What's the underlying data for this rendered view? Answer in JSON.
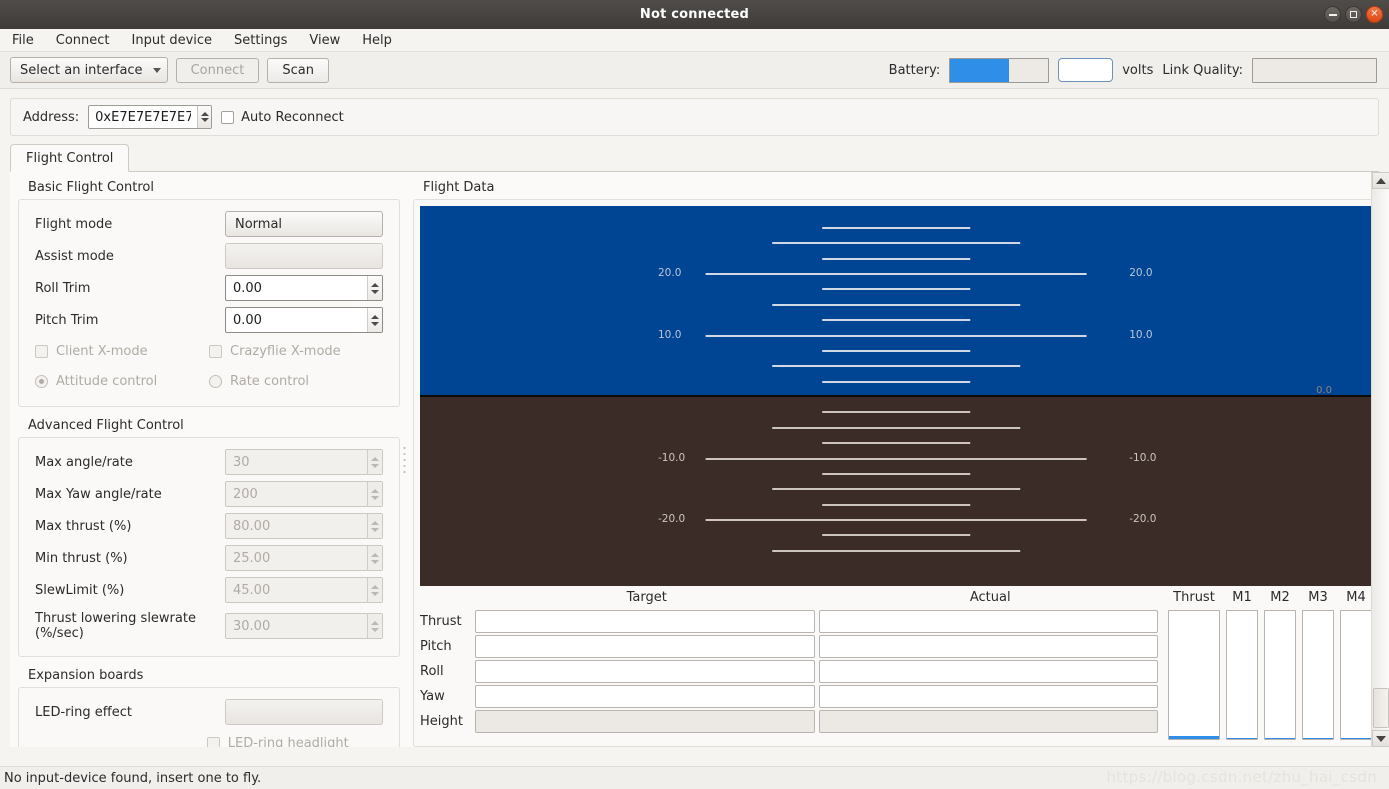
{
  "window": {
    "title": "Not connected",
    "minimize_label": "minimize",
    "maximize_label": "maximize",
    "close_label": "close"
  },
  "menubar": {
    "items": [
      {
        "label": "File"
      },
      {
        "label": "Connect"
      },
      {
        "label": "Input device"
      },
      {
        "label": "Settings"
      },
      {
        "label": "View"
      },
      {
        "label": "Help"
      }
    ]
  },
  "toolbar": {
    "interface_select": "Select an interface",
    "connect_label": "Connect",
    "scan_label": "Scan",
    "battery_label": "Battery:",
    "battery_percent": 60,
    "battery_value": "",
    "volts_label": "volts",
    "link_quality_label": "Link Quality:",
    "link_quality_value": "",
    "accent_color": "#2f8fe8"
  },
  "address_bar": {
    "label": "Address:",
    "value": "0xE7E7E7E7E7",
    "auto_reconnect_label": "Auto Reconnect",
    "auto_reconnect_checked": false
  },
  "tabs": [
    {
      "label": "Flight Control",
      "active": true
    }
  ],
  "basic_flight_control": {
    "title": "Basic Flight Control",
    "rows": [
      {
        "label": "Flight mode",
        "value": "Normal",
        "kind": "combo",
        "disabled": false
      },
      {
        "label": "Assist mode",
        "value": "",
        "kind": "combo",
        "disabled": true
      },
      {
        "label": "Roll Trim",
        "value": "0.00",
        "kind": "spin",
        "disabled": false
      },
      {
        "label": "Pitch Trim",
        "value": "0.00",
        "kind": "spin",
        "disabled": false
      }
    ],
    "checkboxes": [
      {
        "label": "Client X-mode",
        "checked": false,
        "disabled": true
      },
      {
        "label": "Crazyflie X-mode",
        "checked": false,
        "disabled": true
      }
    ],
    "radios": [
      {
        "label": "Attitude control",
        "selected": true,
        "disabled": true
      },
      {
        "label": "Rate control",
        "selected": false,
        "disabled": true
      }
    ]
  },
  "advanced_flight_control": {
    "title": "Advanced Flight Control",
    "rows": [
      {
        "label": "Max angle/rate",
        "value": "30"
      },
      {
        "label": "Max Yaw angle/rate",
        "value": "200"
      },
      {
        "label": "Max thrust (%)",
        "value": "80.00"
      },
      {
        "label": "Min thrust (%)",
        "value": "25.00"
      },
      {
        "label": "SlewLimit (%)",
        "value": "45.00"
      },
      {
        "label": "Thrust lowering slewrate (%/sec)",
        "value": "30.00"
      }
    ]
  },
  "expansion_boards": {
    "title": "Expansion boards",
    "led_ring_effect_label": "LED-ring effect",
    "led_ring_effect_value": "",
    "led_ring_headlight_label": "LED-ring headlight",
    "led_ring_headlight_checked": false
  },
  "flight_data": {
    "title": "Flight Data",
    "attitude_indicator": {
      "sky_color": "#004494",
      "ground_color": "#3b2c27",
      "horizon_color": "#0d0a08",
      "sky_text_color": "#b9c6d8",
      "ground_text_color": "#cdc5bd",
      "horizon_readout": "0.0",
      "pitch": 0.0,
      "roll": 0.0,
      "ladder_labels": [
        "20.0",
        "10.0",
        "-10.0",
        "-20.0"
      ],
      "rungs": [
        {
          "value": 27.5,
          "width": "short"
        },
        {
          "value": 25.0,
          "width": "medium"
        },
        {
          "value": 22.5,
          "width": "short"
        },
        {
          "value": 20.0,
          "width": "long",
          "label": "20.0"
        },
        {
          "value": 17.5,
          "width": "short"
        },
        {
          "value": 15.0,
          "width": "medium"
        },
        {
          "value": 12.5,
          "width": "short"
        },
        {
          "value": 10.0,
          "width": "long",
          "label": "10.0"
        },
        {
          "value": 7.5,
          "width": "short"
        },
        {
          "value": 5.0,
          "width": "medium"
        },
        {
          "value": 2.5,
          "width": "short"
        },
        {
          "value": -2.5,
          "width": "short"
        },
        {
          "value": -5.0,
          "width": "medium"
        },
        {
          "value": -7.5,
          "width": "short"
        },
        {
          "value": -10.0,
          "width": "long",
          "label": "-10.0"
        },
        {
          "value": -12.5,
          "width": "short"
        },
        {
          "value": -15.0,
          "width": "medium"
        },
        {
          "value": -17.5,
          "width": "short"
        },
        {
          "value": -20.0,
          "width": "long",
          "label": "-20.0"
        },
        {
          "value": -22.5,
          "width": "short"
        },
        {
          "value": -25.0,
          "width": "medium"
        }
      ]
    },
    "target_header": "Target",
    "actual_header": "Actual",
    "rows": [
      {
        "label": "Thrust",
        "target": "",
        "actual": "",
        "disabled": false
      },
      {
        "label": "Pitch",
        "target": "",
        "actual": "",
        "disabled": false
      },
      {
        "label": "Roll",
        "target": "",
        "actual": "",
        "disabled": false
      },
      {
        "label": "Yaw",
        "target": "",
        "actual": "",
        "disabled": false
      },
      {
        "label": "Height",
        "target": "",
        "actual": "",
        "disabled": true
      }
    ],
    "motor_bars": [
      {
        "label": "Thrust",
        "value": 2
      },
      {
        "label": "M1",
        "value": 1
      },
      {
        "label": "M2",
        "value": 1
      },
      {
        "label": "M3",
        "value": 1
      },
      {
        "label": "M4",
        "value": 1
      }
    ]
  },
  "statusbar": {
    "message": "No input-device found, insert one to fly."
  },
  "watermark": {
    "text": "https://blog.csdn.net/zhu_hai_csdn"
  }
}
